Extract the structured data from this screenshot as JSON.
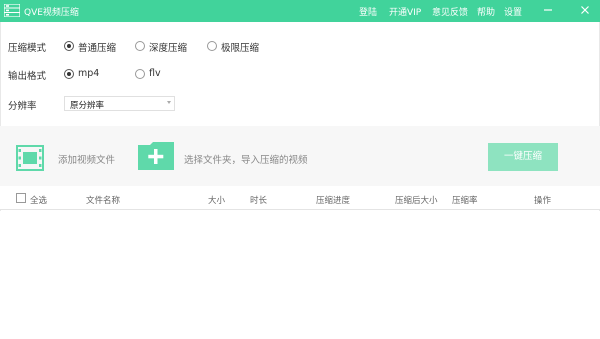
{
  "window": {
    "title": "QVE视频压缩",
    "links": [
      "登陆",
      "开通VIP",
      "意见反馈",
      "帮助",
      "设置"
    ]
  },
  "options": {
    "mode_label": "压缩模式",
    "modes": [
      "普通压缩",
      "深度压缩",
      "极限压缩"
    ],
    "mode_selected": "普通压缩",
    "format_label": "输出格式",
    "formats": [
      "mp4",
      "flv"
    ],
    "format_selected": "mp4",
    "resolution_label": "分辨率",
    "resolution_value": "原分辨率"
  },
  "actions": {
    "add_video": "添加视频文件",
    "add_folder": "选择文件夹，导入压缩的视频",
    "compress": "一键压缩"
  },
  "table": {
    "select_all": "全选",
    "columns": [
      "文件名称",
      "大小",
      "时长",
      "压缩进度",
      "压缩后大小",
      "压缩率",
      "操作"
    ]
  },
  "colors": {
    "accent": "#41d39b",
    "button": "#8ee3c0"
  }
}
